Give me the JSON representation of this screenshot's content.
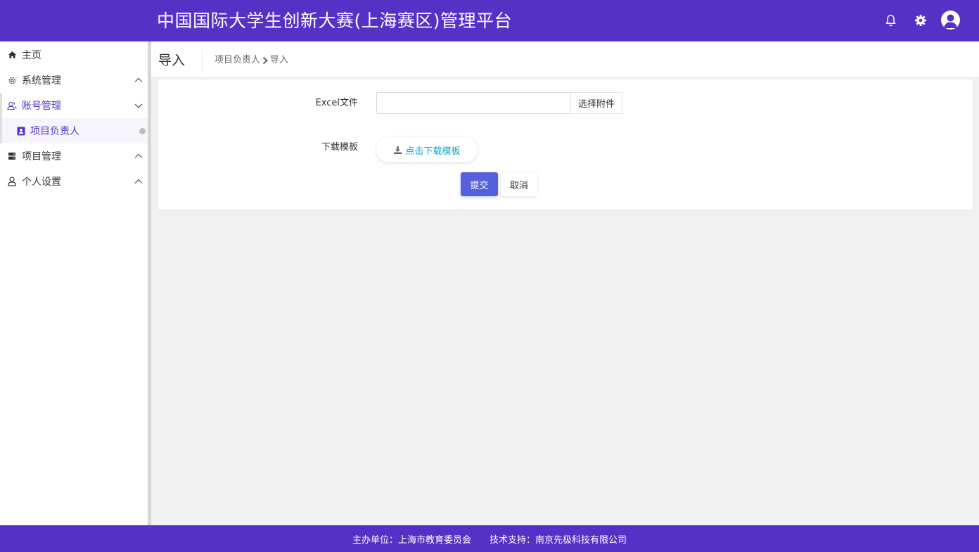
{
  "header": {
    "title": "中国国际大学生创新大赛(上海赛区)管理平台",
    "icons": [
      "bell-icon",
      "gear-icon",
      "avatar-icon"
    ],
    "bg_color": "#5631c5"
  },
  "sidebar": {
    "items": [
      {
        "label": "主页",
        "icon": "home-icon"
      },
      {
        "label": "系统管理",
        "icon": "gear-outline-icon"
      },
      {
        "label": "账号管理",
        "icon": "users-icon"
      },
      {
        "label": "项目负责人",
        "icon": "contact-card-icon"
      },
      {
        "label": "项目管理",
        "icon": "server-icon"
      },
      {
        "label": "个人设置",
        "icon": "user-icon"
      }
    ],
    "active_color": "#5631c5"
  },
  "page": {
    "title": "导入",
    "breadcrumb": [
      "项目负责人",
      "导入"
    ]
  },
  "form": {
    "excel_label": "Excel文件",
    "excel_value": "",
    "choose_label": "选择附件",
    "template_label": "下载模板",
    "download_label": "点击下载模板",
    "submit_label": "提交",
    "cancel_label": "取消"
  },
  "footer": {
    "organizer": "主办单位：上海市教育委员会",
    "support": "技术支持：南京先极科技有限公司"
  }
}
